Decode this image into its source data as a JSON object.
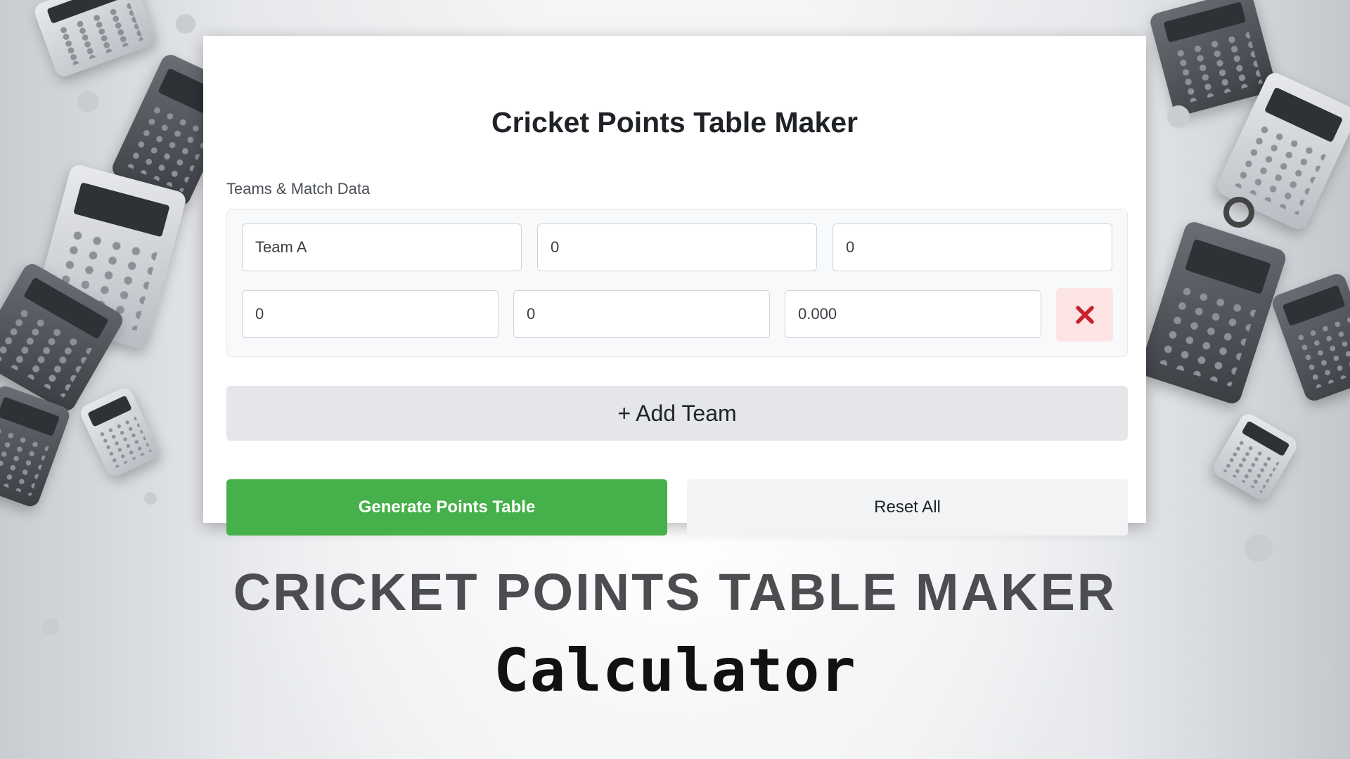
{
  "app": {
    "title": "Cricket Points Table Maker",
    "section_label": "Teams & Match Data"
  },
  "team_row": {
    "team_name": "Team A",
    "matches_played": "0",
    "won": "0",
    "lost": "0",
    "tied": "0",
    "net_run_rate": "0.000",
    "remove_icon": "close-icon"
  },
  "buttons": {
    "add_team": "+ Add Team",
    "generate": "Generate Points Table",
    "reset": "Reset All"
  },
  "banner": {
    "title": "CRICKET POINTS TABLE MAKER",
    "subtitle": "Calculator"
  },
  "colors": {
    "generate_bg": "#46b04a",
    "remove_bg": "#fde4e4",
    "remove_icon": "#c8232c"
  }
}
